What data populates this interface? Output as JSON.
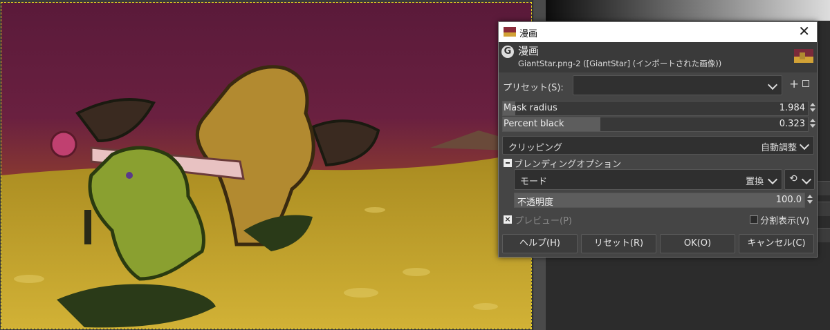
{
  "dialog": {
    "window_title": "漫画",
    "header_title": "漫画",
    "header_subtitle": "GiantStar.png-2 ([GiantStar] (インポートされた画像))",
    "preset_label": "プリセット(S):",
    "preset_value": "",
    "mask_radius": {
      "label": "Mask radius",
      "value": "1.984",
      "fraction": 0.04
    },
    "percent_black": {
      "label": "Percent black",
      "value": "0.323",
      "fraction": 0.32
    },
    "clipping": {
      "label": "クリッピング",
      "value": "自動調整"
    },
    "blending": {
      "section_label": "ブレンディングオプション",
      "mode_label": "モード",
      "mode_value": "置換",
      "opacity_label": "不透明度",
      "opacity_value": "100.0",
      "opacity_fraction": 1.0
    },
    "preview_label": "プレビュー(P)",
    "split_view_label": "分割表示(V)",
    "buttons": {
      "help": "ヘルプ(H)",
      "reset": "リセット(R)",
      "ok": "OK(O)",
      "cancel": "キャンセル(C)"
    }
  },
  "colors": {
    "dialog_bg": "#454545",
    "selection_border": "#e6d21f"
  }
}
